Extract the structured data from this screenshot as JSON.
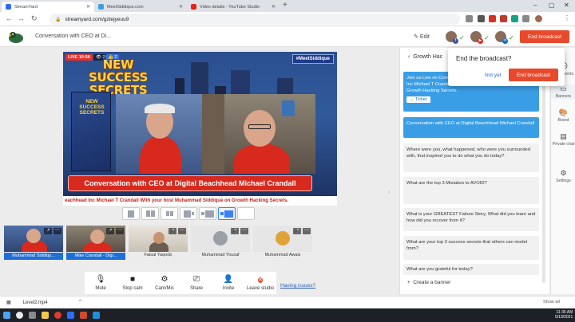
{
  "browser": {
    "tabs": [
      {
        "label": "StreamYard",
        "color": "#2a6ef5"
      },
      {
        "label": "MeetSiddique.com",
        "color": "#3aa0e0"
      },
      {
        "label": "Video details - YouTube Studio",
        "color": "#e62117"
      }
    ],
    "url": "streamyard.com/gztejyeuu9"
  },
  "header": {
    "broadcast_title": "Conversation with CEO at Di...",
    "edit_label": "Edit",
    "end_broadcast_label": "End broadcast"
  },
  "stage": {
    "live_badge": "LIVE 10:56",
    "viewers": "2",
    "likes": "2",
    "hashtag": "#MeetSiddique",
    "promo_title": "NEW SUCCESS SECRETS",
    "book_title": "NEW SUCCESS SECRETS",
    "banner": "Conversation with CEO at Digital Beachhead Michael Crandall",
    "ticker": "eachhead Inc Michael T Crandall With your host Muhammad Siddique on Growth Hacking Secrets."
  },
  "participants": [
    {
      "name": "Muhammad Siddiqu...",
      "on_stage": true
    },
    {
      "name": "Mike Crandall - Digi...",
      "on_stage": true
    },
    {
      "name": "Faisal Yaqoob",
      "on_stage": false
    },
    {
      "name": "Muhammad Yousaf",
      "on_stage": false
    },
    {
      "name": "Muhammad Awais",
      "on_stage": false
    }
  ],
  "controls": [
    {
      "label": "Mute",
      "icon": "mic-icon"
    },
    {
      "label": "Stop cam",
      "icon": "camera-icon"
    },
    {
      "label": "Cam/Mic",
      "icon": "gear-icon"
    },
    {
      "label": "Share",
      "icon": "screen-share-icon"
    },
    {
      "label": "Invite",
      "icon": "add-person-icon"
    },
    {
      "label": "Leave studio",
      "icon": "leave-icon"
    }
  ],
  "having_issues": "Having issues?",
  "panel": {
    "header": "Growth Hac",
    "banners": [
      {
        "text": "Join us Live on Conversation with CEO at Digital Beachhead Inc Michael T Crandall With your host Muhammad Siddique on Growth Hacking Secrets.",
        "ticker": "Ticker",
        "active": true
      },
      {
        "text": "Conversation with CEO at Digital Beachhead Michael Crandall",
        "active": true
      },
      {
        "text": "Where were you, what happened, who were you surrounded with, that inspired you to do what you do today?",
        "active": false
      },
      {
        "text": "What are the top 3 Mistakes to AVOID?",
        "active": false
      },
      {
        "text": "What is your GREATEST Failure Story, What did you learn and how did you recover from it?",
        "active": false
      },
      {
        "text": "What are your top 3 success secrets that others can model from?",
        "active": false
      },
      {
        "text": "What are you grateful for today?",
        "active": false
      }
    ],
    "create_banner": "Create a banner"
  },
  "rail": [
    {
      "label": "Comments",
      "icon": "comment-icon"
    },
    {
      "label": "Banners",
      "icon": "banner-icon"
    },
    {
      "label": "Brand",
      "icon": "palette-icon"
    },
    {
      "label": "Private chat",
      "icon": "chat-icon"
    },
    {
      "label": "Settings",
      "icon": "gear-icon"
    }
  ],
  "popup": {
    "title": "End the broadcast?",
    "cancel": "Not yet",
    "confirm": "End broadcast"
  },
  "downloads": {
    "file": "Level2.mp4",
    "show_all": "Show all"
  },
  "taskbar": {
    "time": "11:35 AM",
    "date": "5/19/2021"
  }
}
